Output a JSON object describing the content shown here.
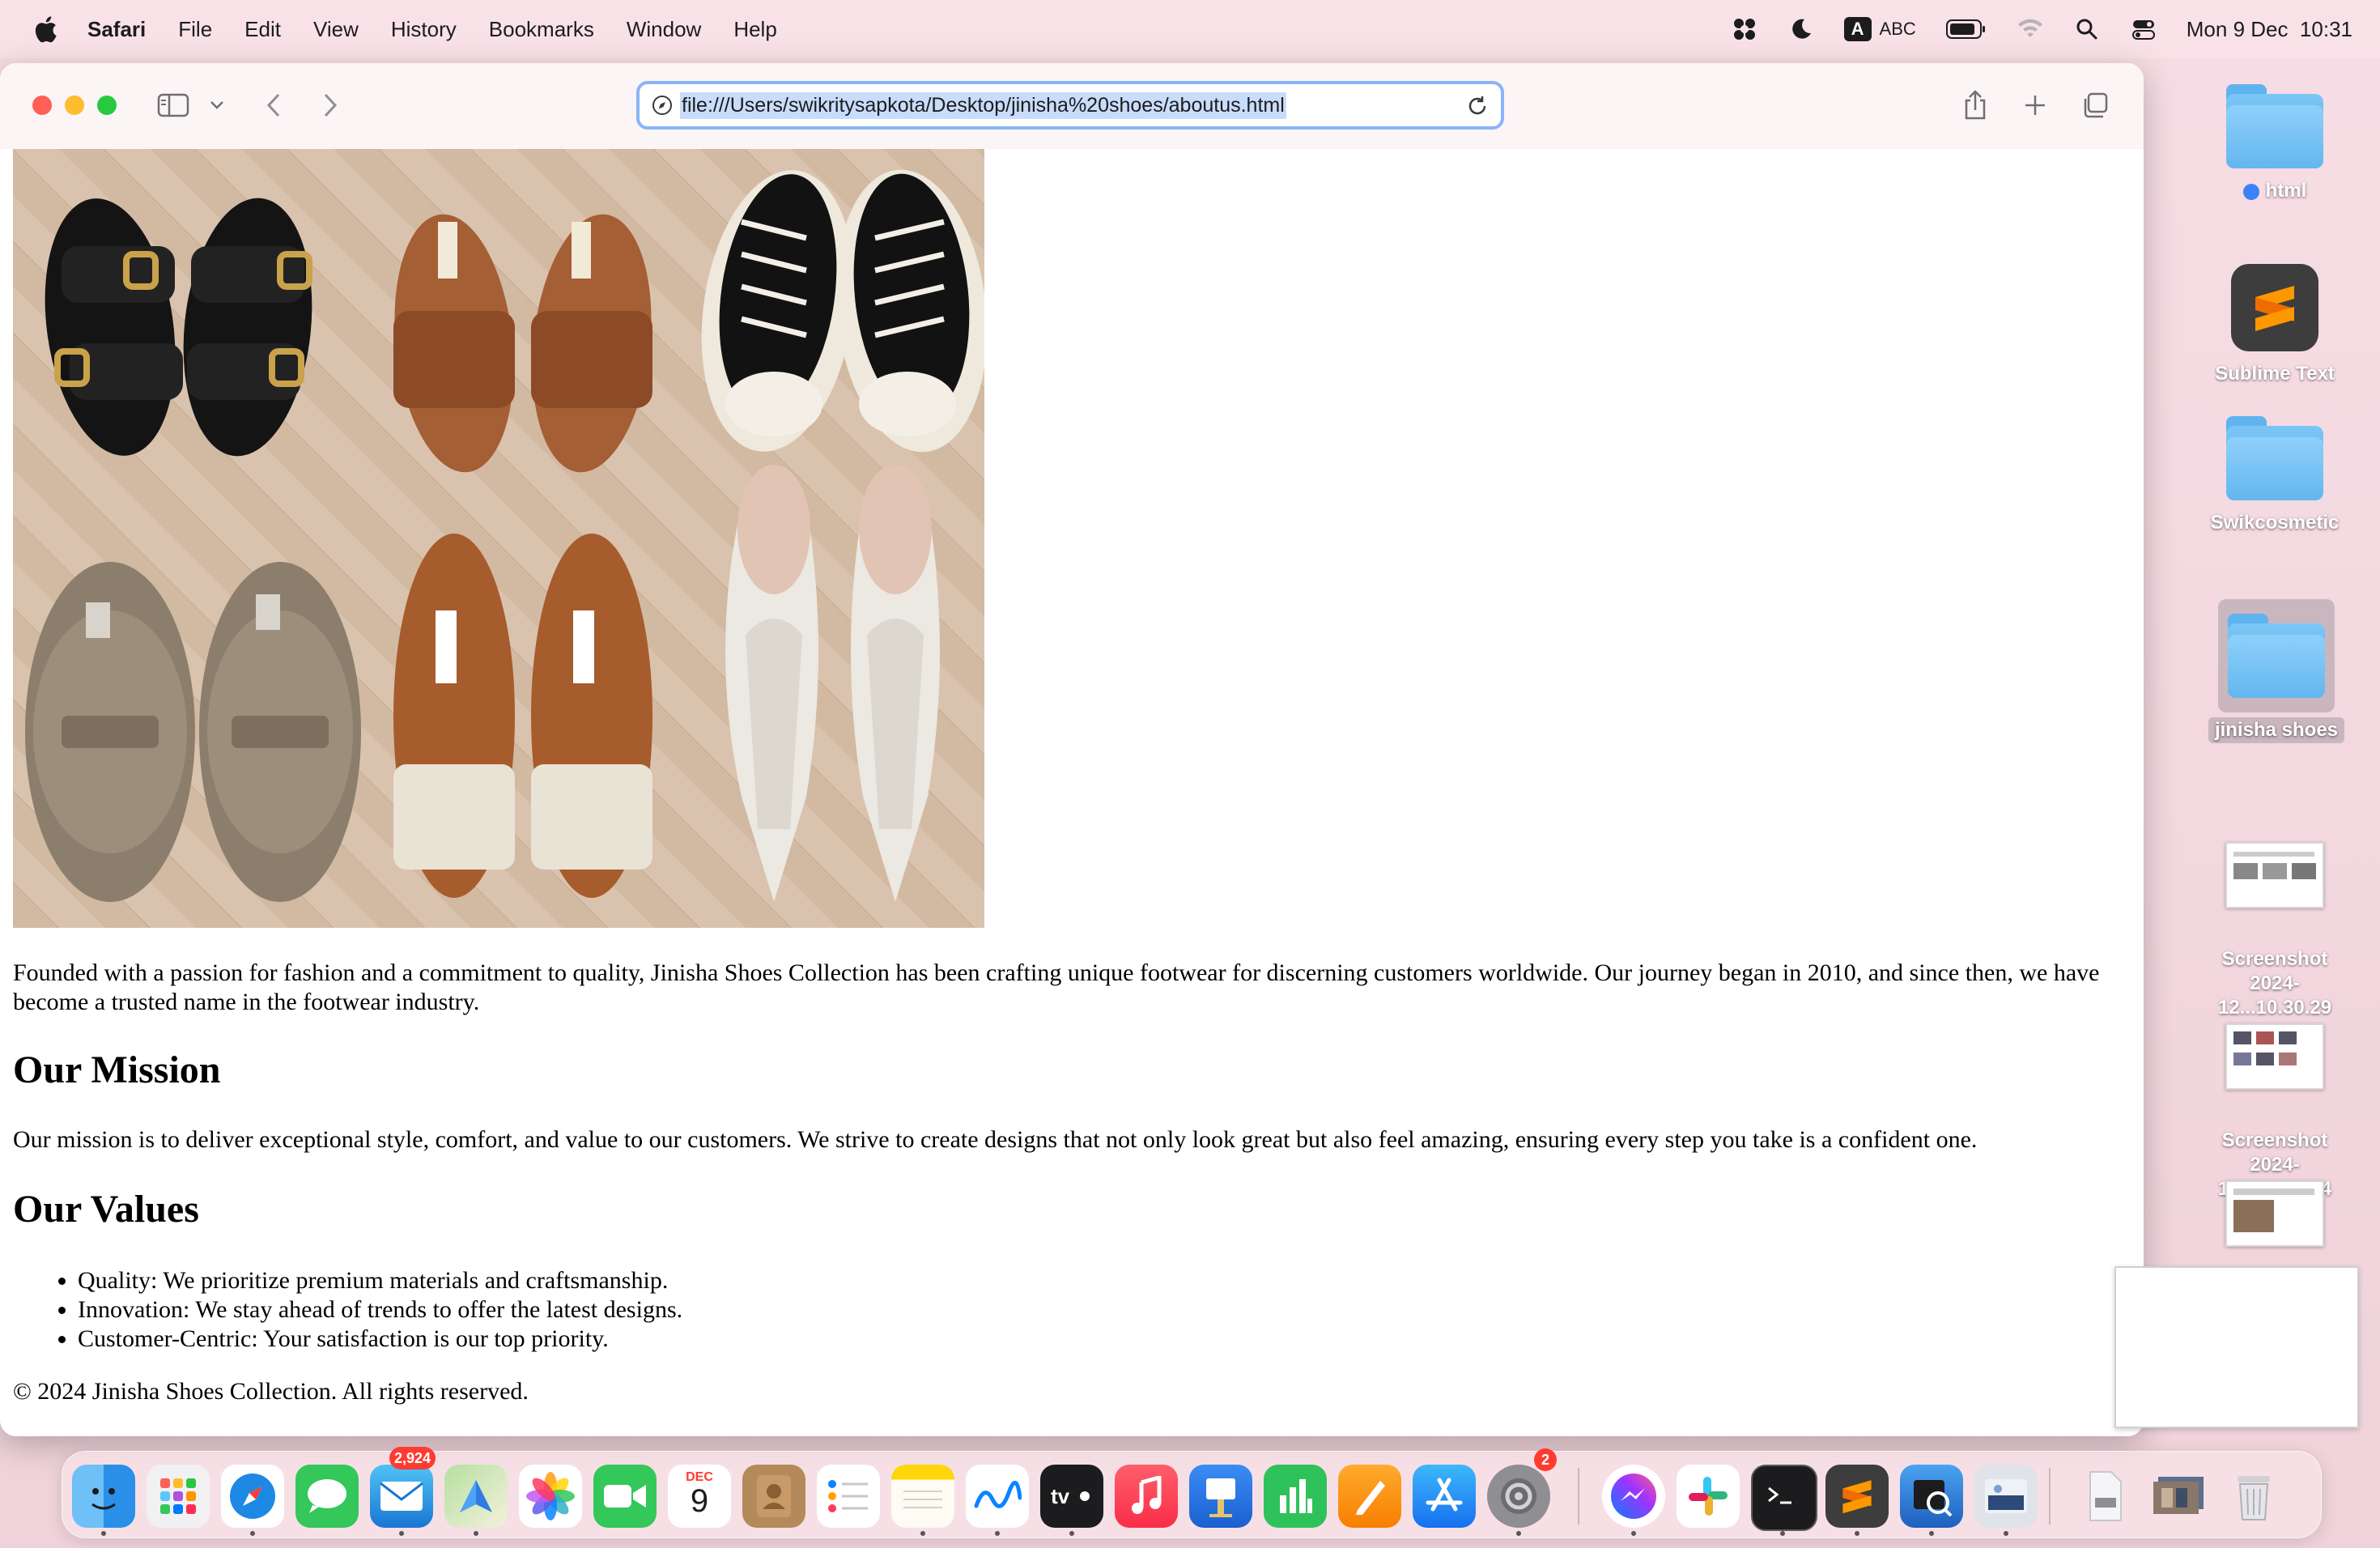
{
  "menubar": {
    "apple_icon": "apple-logo",
    "app_name": "Safari",
    "items": [
      "File",
      "Edit",
      "View",
      "History",
      "Bookmarks",
      "Window",
      "Help"
    ],
    "input_badge": "A",
    "input_source": "ABC",
    "datetime": "Mon 9 Dec  10:31"
  },
  "browser": {
    "url": "file:///Users/swikritysapkota/Desktop/jinisha%20shoes/aboutus.html"
  },
  "page": {
    "image_alt": "Six pairs of shoes: black buckle sandals, tan slides, black high-top sneakers, suede clogs, white heeled mules, white woven slingback pumps",
    "intro": "Founded with a passion for fashion and a commitment to quality, Jinisha Shoes Collection has been crafting unique footwear for discerning customers worldwide. Our journey began in 2010, and since then, we have become a trusted name in the footwear industry.",
    "mission_heading": "Our Mission",
    "mission_text": "Our mission is to deliver exceptional style, comfort, and value to our customers. We strive to create designs that not only look great but also feel amazing, ensuring every step you take is a confident one.",
    "values_heading": "Our Values",
    "values": [
      "Quality: We prioritize premium materials and craftsmanship.",
      "Innovation: We stay ahead of trends to offer the latest designs.",
      "Customer-Centric: Your satisfaction is our top priority."
    ],
    "footer": "© 2024 Jinisha Shoes Collection. All rights reserved."
  },
  "desktop": {
    "items": [
      {
        "label": "html",
        "kind": "folder",
        "tag_color": "#3b82f6"
      },
      {
        "label": "Sublime Text",
        "kind": "app"
      },
      {
        "label": "Swikcosmetic",
        "kind": "folder"
      },
      {
        "label": "jinisha shoes",
        "kind": "folder",
        "selected": true
      },
      {
        "label": "Screenshot\n2024-12...10.30.29",
        "kind": "screenshot"
      },
      {
        "label": "Screenshot\n2024-12...10.30.34",
        "kind": "screenshot"
      }
    ]
  },
  "dock": {
    "mail_badge": "2,924",
    "calendar_month": "DEC",
    "calendar_day": "9",
    "settings_badge": "2",
    "apps": [
      "Finder",
      "Launchpad",
      "Safari",
      "Messages",
      "Mail",
      "Maps",
      "Photos",
      "FaceTime",
      "Calendar",
      "Contacts",
      "Reminders",
      "Notes",
      "Freeform",
      "TV",
      "Music",
      "Keynote",
      "Numbers",
      "Pages",
      "App Store",
      "System Settings",
      "Messenger",
      "Slack",
      "Terminal",
      "Sublime Text",
      "Preview",
      "Preview Document",
      "Document",
      "Screenshot Stack",
      "Trash"
    ]
  },
  "colors": {
    "accent": "#8ab4f8",
    "desktop_bg": "#f3d7df"
  }
}
